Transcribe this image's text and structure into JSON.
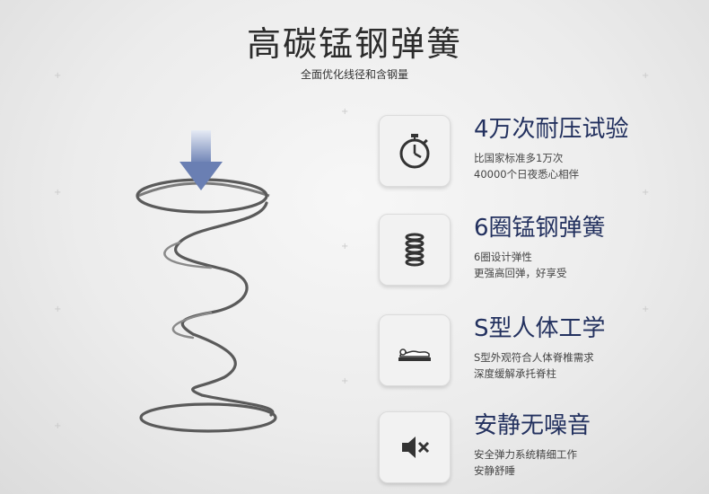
{
  "header": {
    "title": "高碳锰钢弹簧",
    "subtitle": "全面优化线径和含钢量"
  },
  "features": [
    {
      "icon": "stopwatch-icon",
      "title": "4万次耐压试验",
      "line1": "比国家标准多1万次",
      "line2": "40000个日夜悉心相伴"
    },
    {
      "icon": "coil-spring-icon",
      "title": "6圈锰钢弹簧",
      "line1": "6圈设计弹性",
      "line2": "更强高回弹，好享受"
    },
    {
      "icon": "lying-body-icon",
      "title": "S型人体工学",
      "line1": "S型外观符合人体脊椎需求",
      "line2": "深度缓解承托脊柱"
    },
    {
      "icon": "speaker-muted-icon",
      "title": "安静无噪音",
      "line1": "安全弹力系统精细工作",
      "line2": "安静舒睡"
    }
  ],
  "colors": {
    "accent": "#23315f",
    "arrow": "#6a7fb3"
  }
}
